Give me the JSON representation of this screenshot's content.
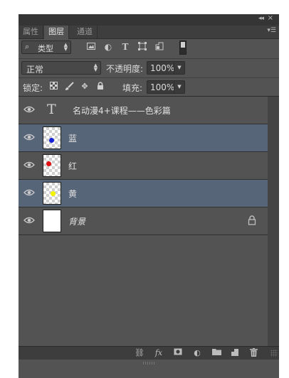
{
  "window": {
    "collapse_icon": "double-chevron-right",
    "close_icon": "close",
    "menu_icon": "panel-menu"
  },
  "tabs": [
    {
      "label": "属性"
    },
    {
      "label": "图层",
      "active": true
    },
    {
      "label": "通道"
    }
  ],
  "filter": {
    "kind_label": "类型",
    "icons": [
      "image-filter",
      "adjustment-filter",
      "type-filter",
      "shape-filter",
      "smart-object-filter"
    ]
  },
  "blend": {
    "mode": "正常",
    "opacity_label": "不透明度:",
    "opacity_value": "100%"
  },
  "lock": {
    "label": "锁定:",
    "fill_label": "填充:",
    "fill_value": "100%",
    "icons": [
      "lock-transparent-pixels",
      "lock-image-pixels",
      "lock-position",
      "lock-all"
    ]
  },
  "layers": [
    {
      "name": "名动漫4+课程——色彩篇",
      "kind": "text",
      "selected": false
    },
    {
      "name": "蓝",
      "kind": "pixel",
      "dot_color": "#1622d6",
      "selected": true
    },
    {
      "name": "红",
      "kind": "pixel",
      "dot_color": "#e01010",
      "selected": false
    },
    {
      "name": "黄",
      "kind": "pixel",
      "dot_color": "#f4f400",
      "selected": true
    },
    {
      "name": "背景",
      "kind": "background",
      "locked": true,
      "selected": false
    }
  ],
  "footer_icons": [
    "link-layers",
    "fx-layer-style",
    "add-mask",
    "new-adjustment-layer",
    "new-group",
    "new-layer",
    "delete-layer"
  ],
  "colors": {
    "panel_bg": "#535353",
    "selected_layer": "#576578",
    "tab_bar": "#3e3e3e"
  }
}
